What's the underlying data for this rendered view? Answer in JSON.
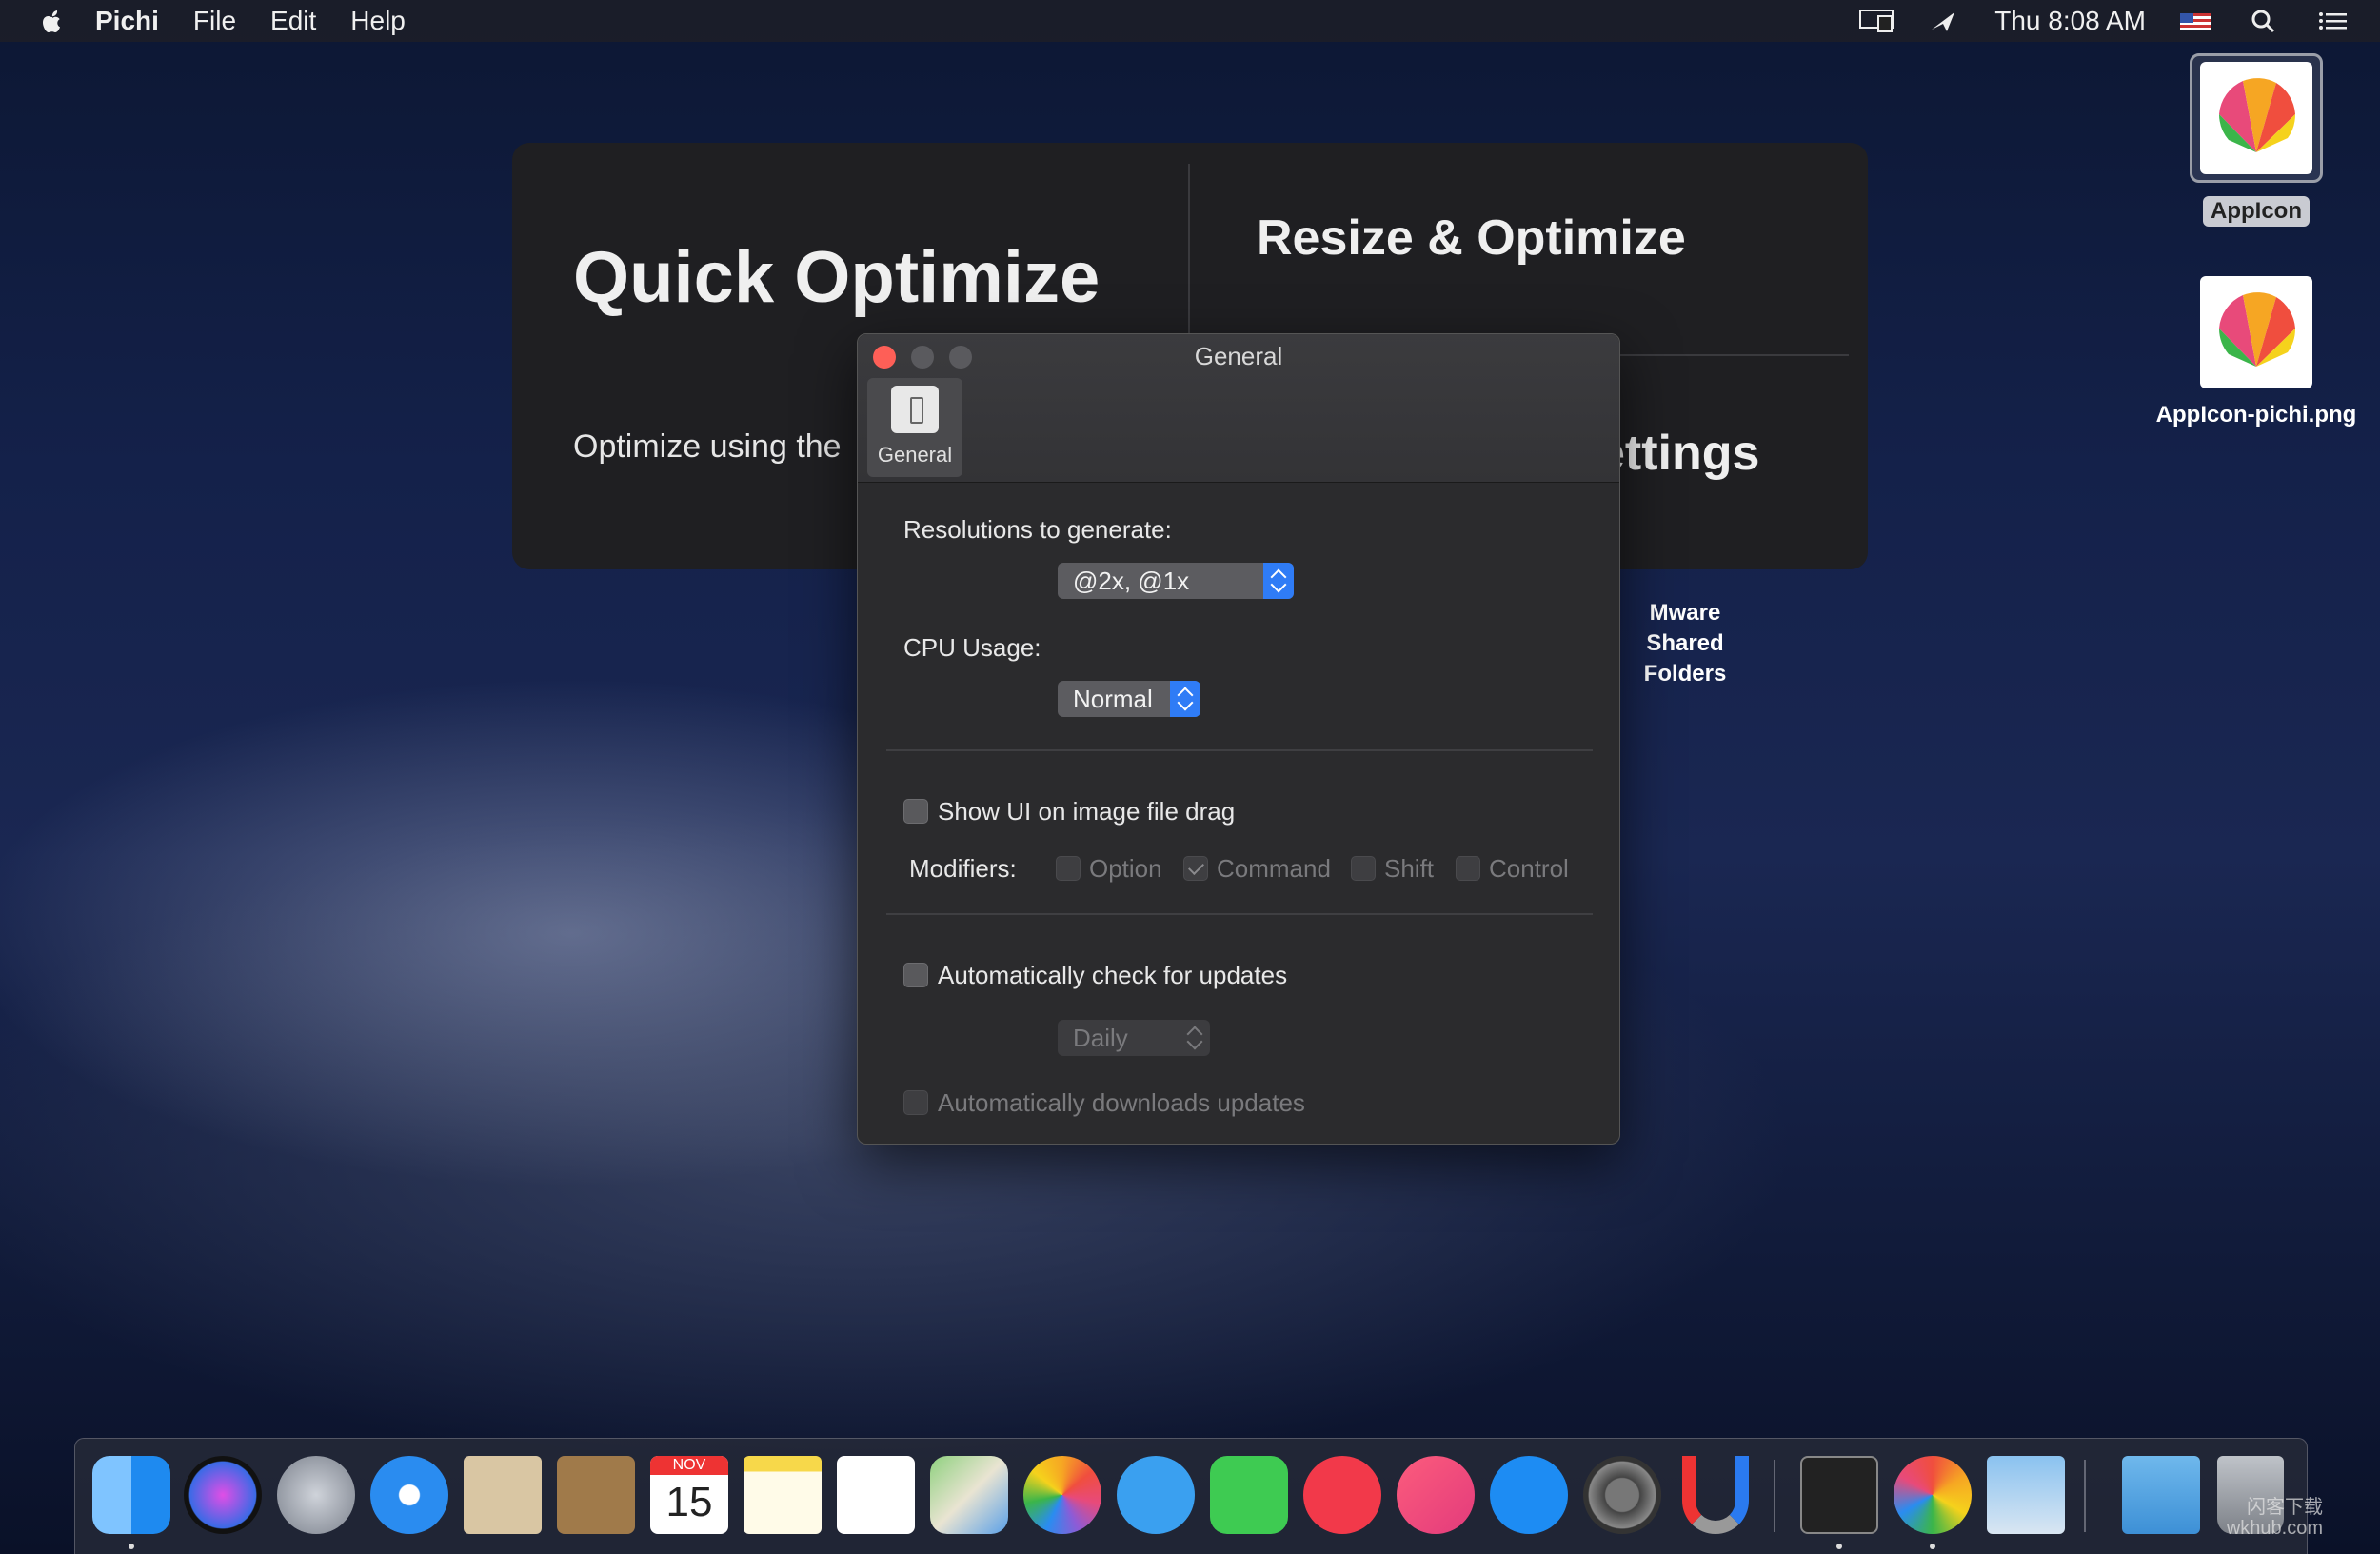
{
  "menubar": {
    "app_name": "Pichi",
    "items": [
      "File",
      "Edit",
      "Help"
    ],
    "clock": "Thu 8:08 AM"
  },
  "background_app": {
    "quick_title": "Quick Optimize",
    "quick_subtitle": "Optimize using the",
    "resize_title": "Resize & Optimize",
    "settings_title": "ettings"
  },
  "desktop": {
    "icons": [
      {
        "label": "AppIcon",
        "selected": true
      },
      {
        "label": "AppIcon-pichi.png",
        "selected": false
      }
    ],
    "vmware_label": "Mware Shared Folders"
  },
  "prefs": {
    "window_title": "General",
    "toolbar_item": "General",
    "resolutions_label": "Resolutions to generate:",
    "resolutions_value": "@2x, @1x",
    "cpu_label": "CPU Usage:",
    "cpu_value": "Normal",
    "show_ui_label": "Show UI on image file drag",
    "modifiers_label": "Modifiers:",
    "modifiers": [
      {
        "label": "Option",
        "checked": false
      },
      {
        "label": "Command",
        "checked": true
      },
      {
        "label": "Shift",
        "checked": false
      },
      {
        "label": "Control",
        "checked": false
      }
    ],
    "auto_check_label": "Automatically check for updates",
    "update_frequency": "Daily",
    "auto_download_label": "Automatically downloads updates"
  },
  "dock": {
    "apps": [
      "finder-icon",
      "siri-icon",
      "launchpad-icon",
      "safari-icon",
      "mail-icon",
      "contacts-icon",
      "calendar-icon",
      "notes-icon",
      "reminders-icon",
      "maps-icon",
      "photos-icon",
      "messages-icon",
      "facetime-icon",
      "news-icon",
      "music-icon",
      "app-store-icon",
      "system-preferences-icon",
      "magnet-icon",
      "terminal-icon",
      "pichi-icon",
      "preview-icon",
      "downloads-folder-icon",
      "trash-icon"
    ],
    "calendar_month": "NOV",
    "calendar_day": "15"
  },
  "watermark": {
    "line1": "闪客下载",
    "line2": "wkhub.com"
  },
  "colors": {
    "accent": "#2f7cf6",
    "close": "#fe5f57"
  }
}
